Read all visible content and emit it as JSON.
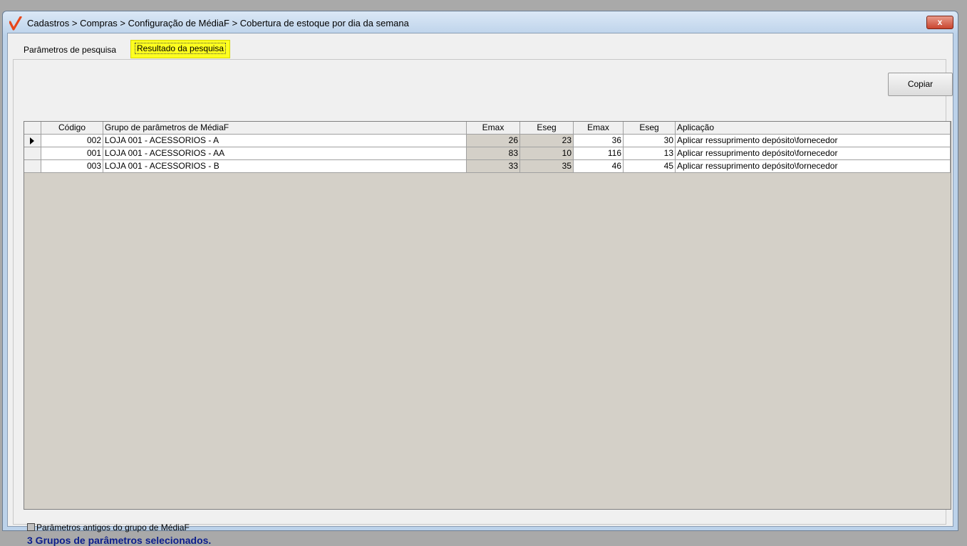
{
  "window": {
    "title": "Cadastros > Compras > Configuração de MédiaF > Cobertura de estoque por dia da semana",
    "close_label": "x"
  },
  "tabs": {
    "search": "Parâmetros de pesquisa",
    "result": "Resultado da pesquisa"
  },
  "toolbar": {
    "copy_label": "Copiar"
  },
  "grid": {
    "headers": [
      "Código",
      "Grupo de parâmetros de MédiaF",
      "Emax",
      "Eseg",
      "Emax",
      "Eseg",
      "Aplicação"
    ],
    "rows": [
      {
        "code": "002",
        "group": "LOJA 001 - ACESSORIOS - A",
        "emax1": "26",
        "eseg1": "23",
        "emax2": "36",
        "eseg2": "30",
        "app": "Aplicar ressuprimento depósito\\fornecedor"
      },
      {
        "code": "001",
        "group": "LOJA 001 - ACESSORIOS - AA",
        "emax1": "83",
        "eseg1": "10",
        "emax2": "116",
        "eseg2": "13",
        "app": "Aplicar ressuprimento depósito\\fornecedor"
      },
      {
        "code": "003",
        "group": "LOJA 001 - ACESSORIOS - B",
        "emax1": "33",
        "eseg1": "35",
        "emax2": "46",
        "eseg2": "45",
        "app": "Aplicar ressuprimento depósito\\fornecedor"
      }
    ]
  },
  "legend": "Parâmetros antigos do grupo de MédiaF",
  "status": "3 Grupos de parâmetros selecionados.",
  "colors": {
    "tab_highlight": "#ffff1f",
    "status_text": "#0c1e8c",
    "grid_background": "#d4d0c8"
  }
}
